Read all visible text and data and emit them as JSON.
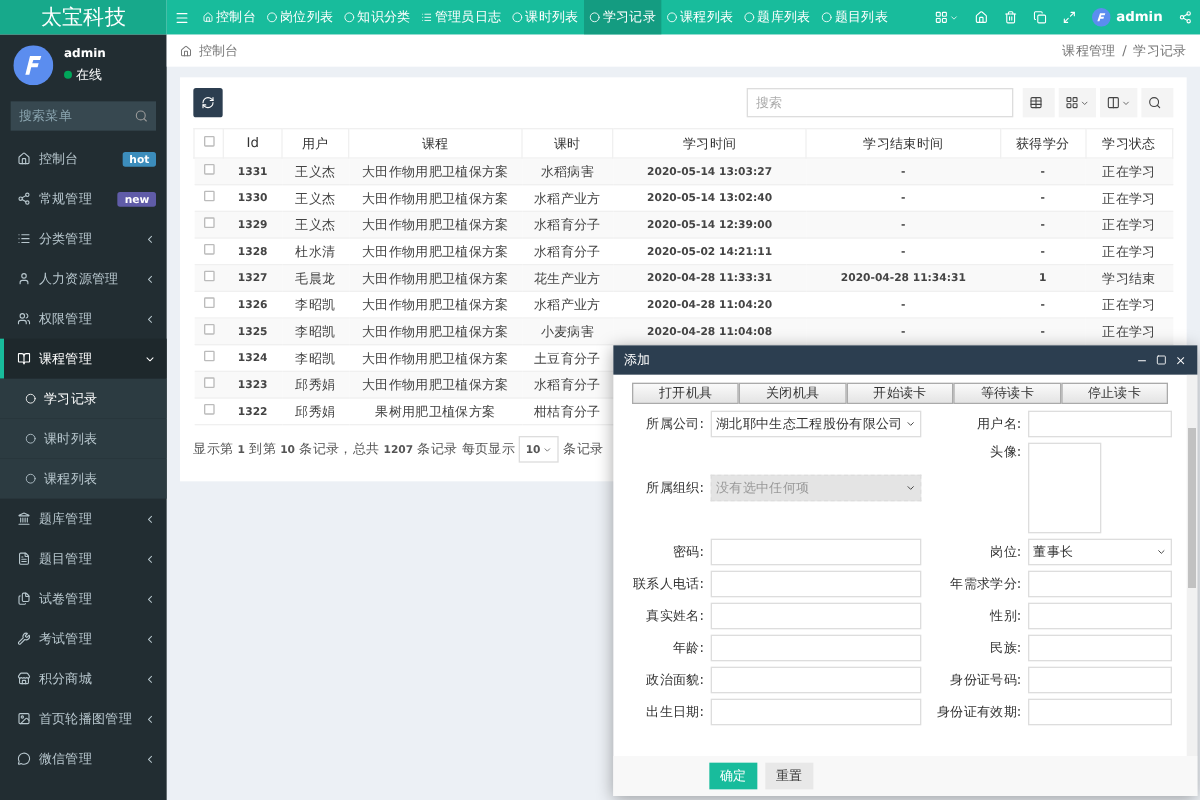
{
  "brand": "太宝科技",
  "nav": {
    "tabs": [
      {
        "label": "控制台",
        "selected": false
      },
      {
        "label": "岗位列表",
        "selected": false
      },
      {
        "label": "知识分类",
        "selected": false
      },
      {
        "label": "管理员日志",
        "selected": false
      },
      {
        "label": "课时列表",
        "selected": false
      },
      {
        "label": "学习记录",
        "selected": true
      },
      {
        "label": "课程列表",
        "selected": false
      },
      {
        "label": "题库列表",
        "selected": false
      },
      {
        "label": "题目列表",
        "selected": false
      }
    ],
    "user": "admin"
  },
  "sidebar": {
    "user": {
      "name": "admin",
      "status": "在线"
    },
    "search": {
      "placeholder": "搜索菜单"
    },
    "items": [
      {
        "label": "控制台",
        "selected": false,
        "badge": {
          "text": "hot",
          "color": "#3c8dbc"
        }
      },
      {
        "label": "常规管理",
        "selected": false,
        "badge": {
          "text": "new",
          "color": "#605ca8"
        }
      },
      {
        "label": "分类管理",
        "selected": false,
        "expanded": false
      },
      {
        "label": "人力资源管理",
        "selected": false,
        "expanded": false
      },
      {
        "label": "权限管理",
        "selected": false,
        "expanded": false
      },
      {
        "label": "课程管理",
        "selected": true,
        "expanded": true,
        "children": [
          {
            "label": "学习记录",
            "selected": true
          },
          {
            "label": "课时列表",
            "selected": false
          },
          {
            "label": "课程列表",
            "selected": false
          }
        ]
      },
      {
        "label": "题库管理",
        "selected": false,
        "expanded": false
      },
      {
        "label": "题目管理",
        "selected": false,
        "expanded": false
      },
      {
        "label": "试卷管理",
        "selected": false,
        "expanded": false
      },
      {
        "label": "考试管理",
        "selected": false,
        "expanded": false
      },
      {
        "label": "积分商城",
        "selected": false,
        "expanded": false
      },
      {
        "label": "首页轮播图管理",
        "selected": false,
        "expanded": false
      },
      {
        "label": "微信管理",
        "selected": false,
        "expanded": false
      }
    ]
  },
  "breadcrumb": {
    "home": "控制台",
    "path": [
      "课程管理",
      "学习记录"
    ],
    "separator": "/"
  },
  "toolbar": {
    "search": {
      "placeholder": "搜索"
    }
  },
  "table": {
    "all_checked": false,
    "columns": [
      "Id",
      "用户",
      "课程",
      "课时",
      "学习时间",
      "学习结束时间",
      "获得学分",
      "学习状态"
    ],
    "rows": [
      {
        "checked": false,
        "cells": [
          "1331",
          "王义杰",
          "大田作物用肥卫植保方案",
          "水稻病害",
          "2020-05-14 13:03:27",
          "-",
          "-",
          "正在学习"
        ]
      },
      {
        "checked": false,
        "cells": [
          "1330",
          "王义杰",
          "大田作物用肥卫植保方案",
          "水稻产业方",
          "2020-05-14 13:02:40",
          "-",
          "-",
          "正在学习"
        ]
      },
      {
        "checked": false,
        "cells": [
          "1329",
          "王义杰",
          "大田作物用肥卫植保方案",
          "水稻育分子",
          "2020-05-14 12:39:00",
          "-",
          "-",
          "正在学习"
        ]
      },
      {
        "checked": false,
        "cells": [
          "1328",
          "杜水清",
          "大田作物用肥卫植保方案",
          "水稻育分子",
          "2020-05-02 14:21:11",
          "-",
          "-",
          "正在学习"
        ]
      },
      {
        "checked": false,
        "cells": [
          "1327",
          "毛晨龙",
          "大田作物用肥卫植保方案",
          "花生产业方",
          "2020-04-28 11:33:31",
          "2020-04-28 11:34:31",
          "1",
          "学习结束"
        ]
      },
      {
        "checked": false,
        "cells": [
          "1326",
          "李昭凯",
          "大田作物用肥卫植保方案",
          "水稻产业方",
          "2020-04-28 11:04:20",
          "-",
          "-",
          "正在学习"
        ]
      },
      {
        "checked": false,
        "cells": [
          "1325",
          "李昭凯",
          "大田作物用肥卫植保方案",
          "小麦病害",
          "2020-04-28 11:04:08",
          "-",
          "-",
          "正在学习"
        ]
      },
      {
        "checked": false,
        "cells": [
          "1324",
          "李昭凯",
          "大田作物用肥卫植保方案",
          "土豆育分子"
        ]
      },
      {
        "checked": false,
        "cells": [
          "1323",
          "邱秀娟",
          "大田作物用肥卫植保方案",
          "水稻育分子"
        ]
      },
      {
        "checked": false,
        "cells": [
          "1322",
          "邱秀娟",
          "果树用肥卫植保方案",
          "柑桔育分子"
        ]
      }
    ]
  },
  "pagination": {
    "summary": "显示第 **1** 到第 **10** 条记录，总共 **1207** 条记录 每页显示",
    "page_size": "10",
    "suffix": "条记录"
  },
  "dialog": {
    "title": "添加",
    "tools": [
      "打开机具",
      "关闭机具",
      "开始读卡",
      "等待读卡",
      "停止读卡"
    ],
    "fields": [
      {
        "label": "所属公司:",
        "kind": "select",
        "value": "湖北耶中生态工程股份有限公司",
        "disabled": false
      },
      {
        "label": "用户名:",
        "kind": "input"
      },
      {
        "label": "所属组织:",
        "kind": "select",
        "placeholder": "没有选中任何项",
        "disabled": true
      },
      {
        "label": "头像:",
        "kind": "image"
      },
      {
        "label": "密码:",
        "kind": "input"
      },
      {
        "label": "岗位:",
        "kind": "select",
        "value": "董事长",
        "disabled": false
      },
      {
        "label": "联系人电话:",
        "kind": "input"
      },
      {
        "label": "年需求学分:",
        "kind": "input"
      },
      {
        "label": "真实姓名:",
        "kind": "input"
      },
      {
        "label": "性别:",
        "kind": "input"
      },
      {
        "label": "年龄:",
        "kind": "input"
      },
      {
        "label": "民族:",
        "kind": "input"
      },
      {
        "label": "政治面貌:",
        "kind": "input"
      },
      {
        "label": "身份证号码:",
        "kind": "input"
      },
      {
        "label": "出生日期:",
        "kind": "input"
      },
      {
        "label": "身份证有效期:",
        "kind": "input"
      }
    ],
    "actions": [
      {
        "label": "确定",
        "primary": true
      },
      {
        "label": "重置",
        "primary": false
      }
    ]
  }
}
